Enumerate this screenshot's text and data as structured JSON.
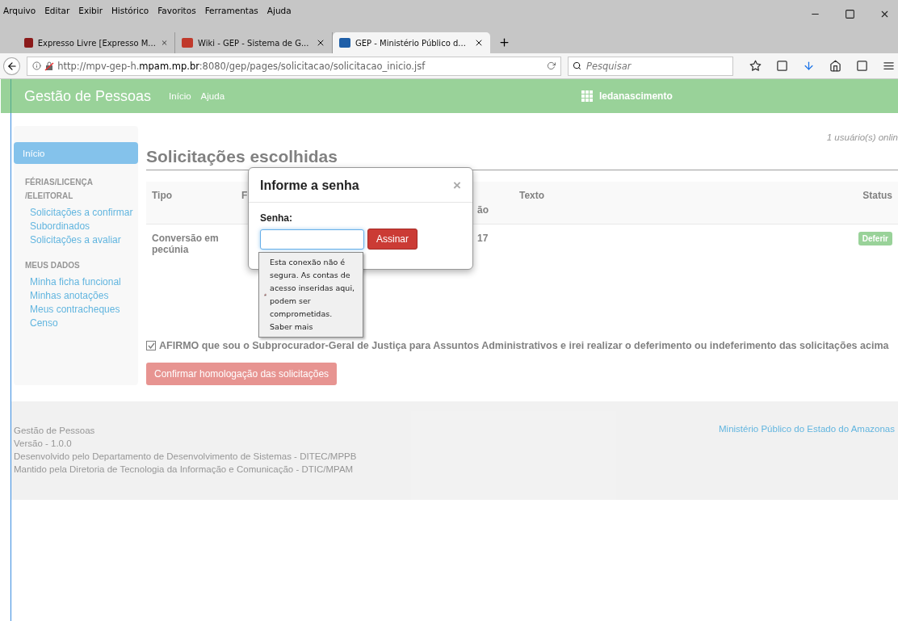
{
  "menu_bar": [
    "Arquivo",
    "Editar",
    "Exibir",
    "Histórico",
    "Favoritos",
    "Ferramentas",
    "Ajuda"
  ],
  "tabs": [
    {
      "label": "Expresso Livre [Expresso M...",
      "selected": false,
      "kind": "mail"
    },
    {
      "label": "Wiki - GEP - Sistema de G...",
      "selected": false,
      "kind": "wiki"
    },
    {
      "label": "GEP - Ministério Público d...",
      "selected": true,
      "kind": "gep"
    }
  ],
  "address_bar": {
    "prefix": "http://mpv-gep-h.",
    "domain": "mpam.mp.br",
    "suffix": ":8080/gep/pages/solicitacao/solicitacao_inicio.jsf"
  },
  "search": {
    "placeholder": "Pesquisar"
  },
  "app_header": {
    "title": "Gestão de Pessoas",
    "nav": [
      "Início",
      "Ajuda"
    ],
    "user": "ledanascimento"
  },
  "online_users": "1 usuário(s) onlin",
  "sidebar": {
    "items": [
      {
        "label": "Início",
        "selected": true
      }
    ],
    "sections": [
      {
        "heading": "FÉRIAS/LICENÇA /ELEITORAL",
        "links": [
          "Solicitações a confirmar",
          "Subordinados",
          "Solicitações a avaliar"
        ]
      },
      {
        "heading": "MEUS DADOS",
        "links": [
          "Minha ficha funcional",
          "Minhas anotações",
          "Meus contracheques",
          "Censo"
        ]
      }
    ]
  },
  "page_title": "Solicitações escolhidas",
  "table": {
    "columns": [
      "Tipo",
      "F",
      "ão",
      "Texto",
      "Status"
    ],
    "rows": [
      {
        "cells": [
          "Conversão em pecúnia",
          "",
          "17",
          ""
        ],
        "status": "Deferir"
      }
    ]
  },
  "affirmation": {
    "text": "AFIRMO que sou o Subprocurador-Geral de Justiça para Assuntos Administrativos e irei realizar o deferimento ou indeferimento das solicitações acima",
    "checked": true
  },
  "confirm_button": "Confirmar homologação das solicitações",
  "footer": {
    "lines": [
      "Gestão de Pessoas",
      "Versão - 1.0.0",
      "Desenvolvido pelo Departamento de Desenvolvimento de Sistemas - DITEC/MPPB",
      "Mantido pela Diretoria de Tecnologia da Informação e Comunicação - DTIC/MPAM"
    ],
    "link": "Ministério Público do Estado do Amazonas"
  },
  "modal": {
    "title": "Informe a senha",
    "close": "×",
    "field_label": "Senha:",
    "button": "Assinar"
  },
  "security_tooltip": {
    "text": "Esta conexão não é segura. As contas de acesso inseridas aqui, podem ser comprometidas.",
    "link": "Saber mais"
  }
}
